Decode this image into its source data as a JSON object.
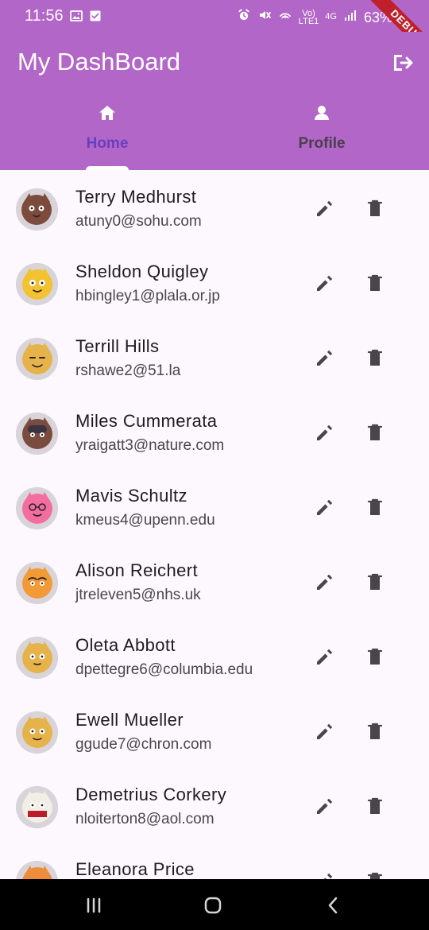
{
  "status_bar": {
    "time": "11:56",
    "left_icons": [
      "image-icon",
      "check-box-icon"
    ],
    "right_icons": [
      "alarm-icon",
      "mute-icon",
      "hotspot-icon",
      "signal-icon"
    ],
    "network_top": "Vo)",
    "network_bottom": "LTE1",
    "network_type": "4G",
    "battery": "63%",
    "debug_label": "DEBUG"
  },
  "app_bar": {
    "title": "My DashBoard",
    "logout_icon": "logout-icon"
  },
  "tabs": [
    {
      "label": "Home",
      "icon": "home-icon",
      "selected": true
    },
    {
      "label": "Profile",
      "icon": "person-icon",
      "selected": false
    }
  ],
  "users": [
    {
      "name": "Terry Medhurst",
      "email": "atuny0@sohu.com",
      "avatar_color": "#7c4b3c"
    },
    {
      "name": "Sheldon Quigley",
      "email": "hbingley1@plala.or.jp",
      "avatar_color": "#f2c230"
    },
    {
      "name": "Terrill Hills",
      "email": "rshawe2@51.la",
      "avatar_color": "#e6b34b"
    },
    {
      "name": "Miles Cummerata",
      "email": "yraigatt3@nature.com",
      "avatar_color": "#7a4c3f"
    },
    {
      "name": "Mavis Schultz",
      "email": "kmeus4@upenn.edu",
      "avatar_color": "#f26ea0"
    },
    {
      "name": "Alison Reichert",
      "email": "jtreleven5@nhs.uk",
      "avatar_color": "#f19a36"
    },
    {
      "name": "Oleta Abbott",
      "email": "dpettegre6@columbia.edu",
      "avatar_color": "#e5b34a"
    },
    {
      "name": "Ewell Mueller",
      "email": "ggude7@chron.com",
      "avatar_color": "#e6b34b"
    },
    {
      "name": "Demetrius Corkery",
      "email": "nloiterton8@aol.com",
      "avatar_color": "#f1eee6"
    },
    {
      "name": "Eleanora Price",
      "email": "",
      "avatar_color": "#ed8d3b"
    }
  ],
  "row_actions": {
    "edit_icon": "edit-icon",
    "delete_icon": "trash-icon"
  },
  "bottom_nav": {
    "items": [
      "recent-apps-icon",
      "home-circle-icon",
      "back-icon"
    ]
  }
}
